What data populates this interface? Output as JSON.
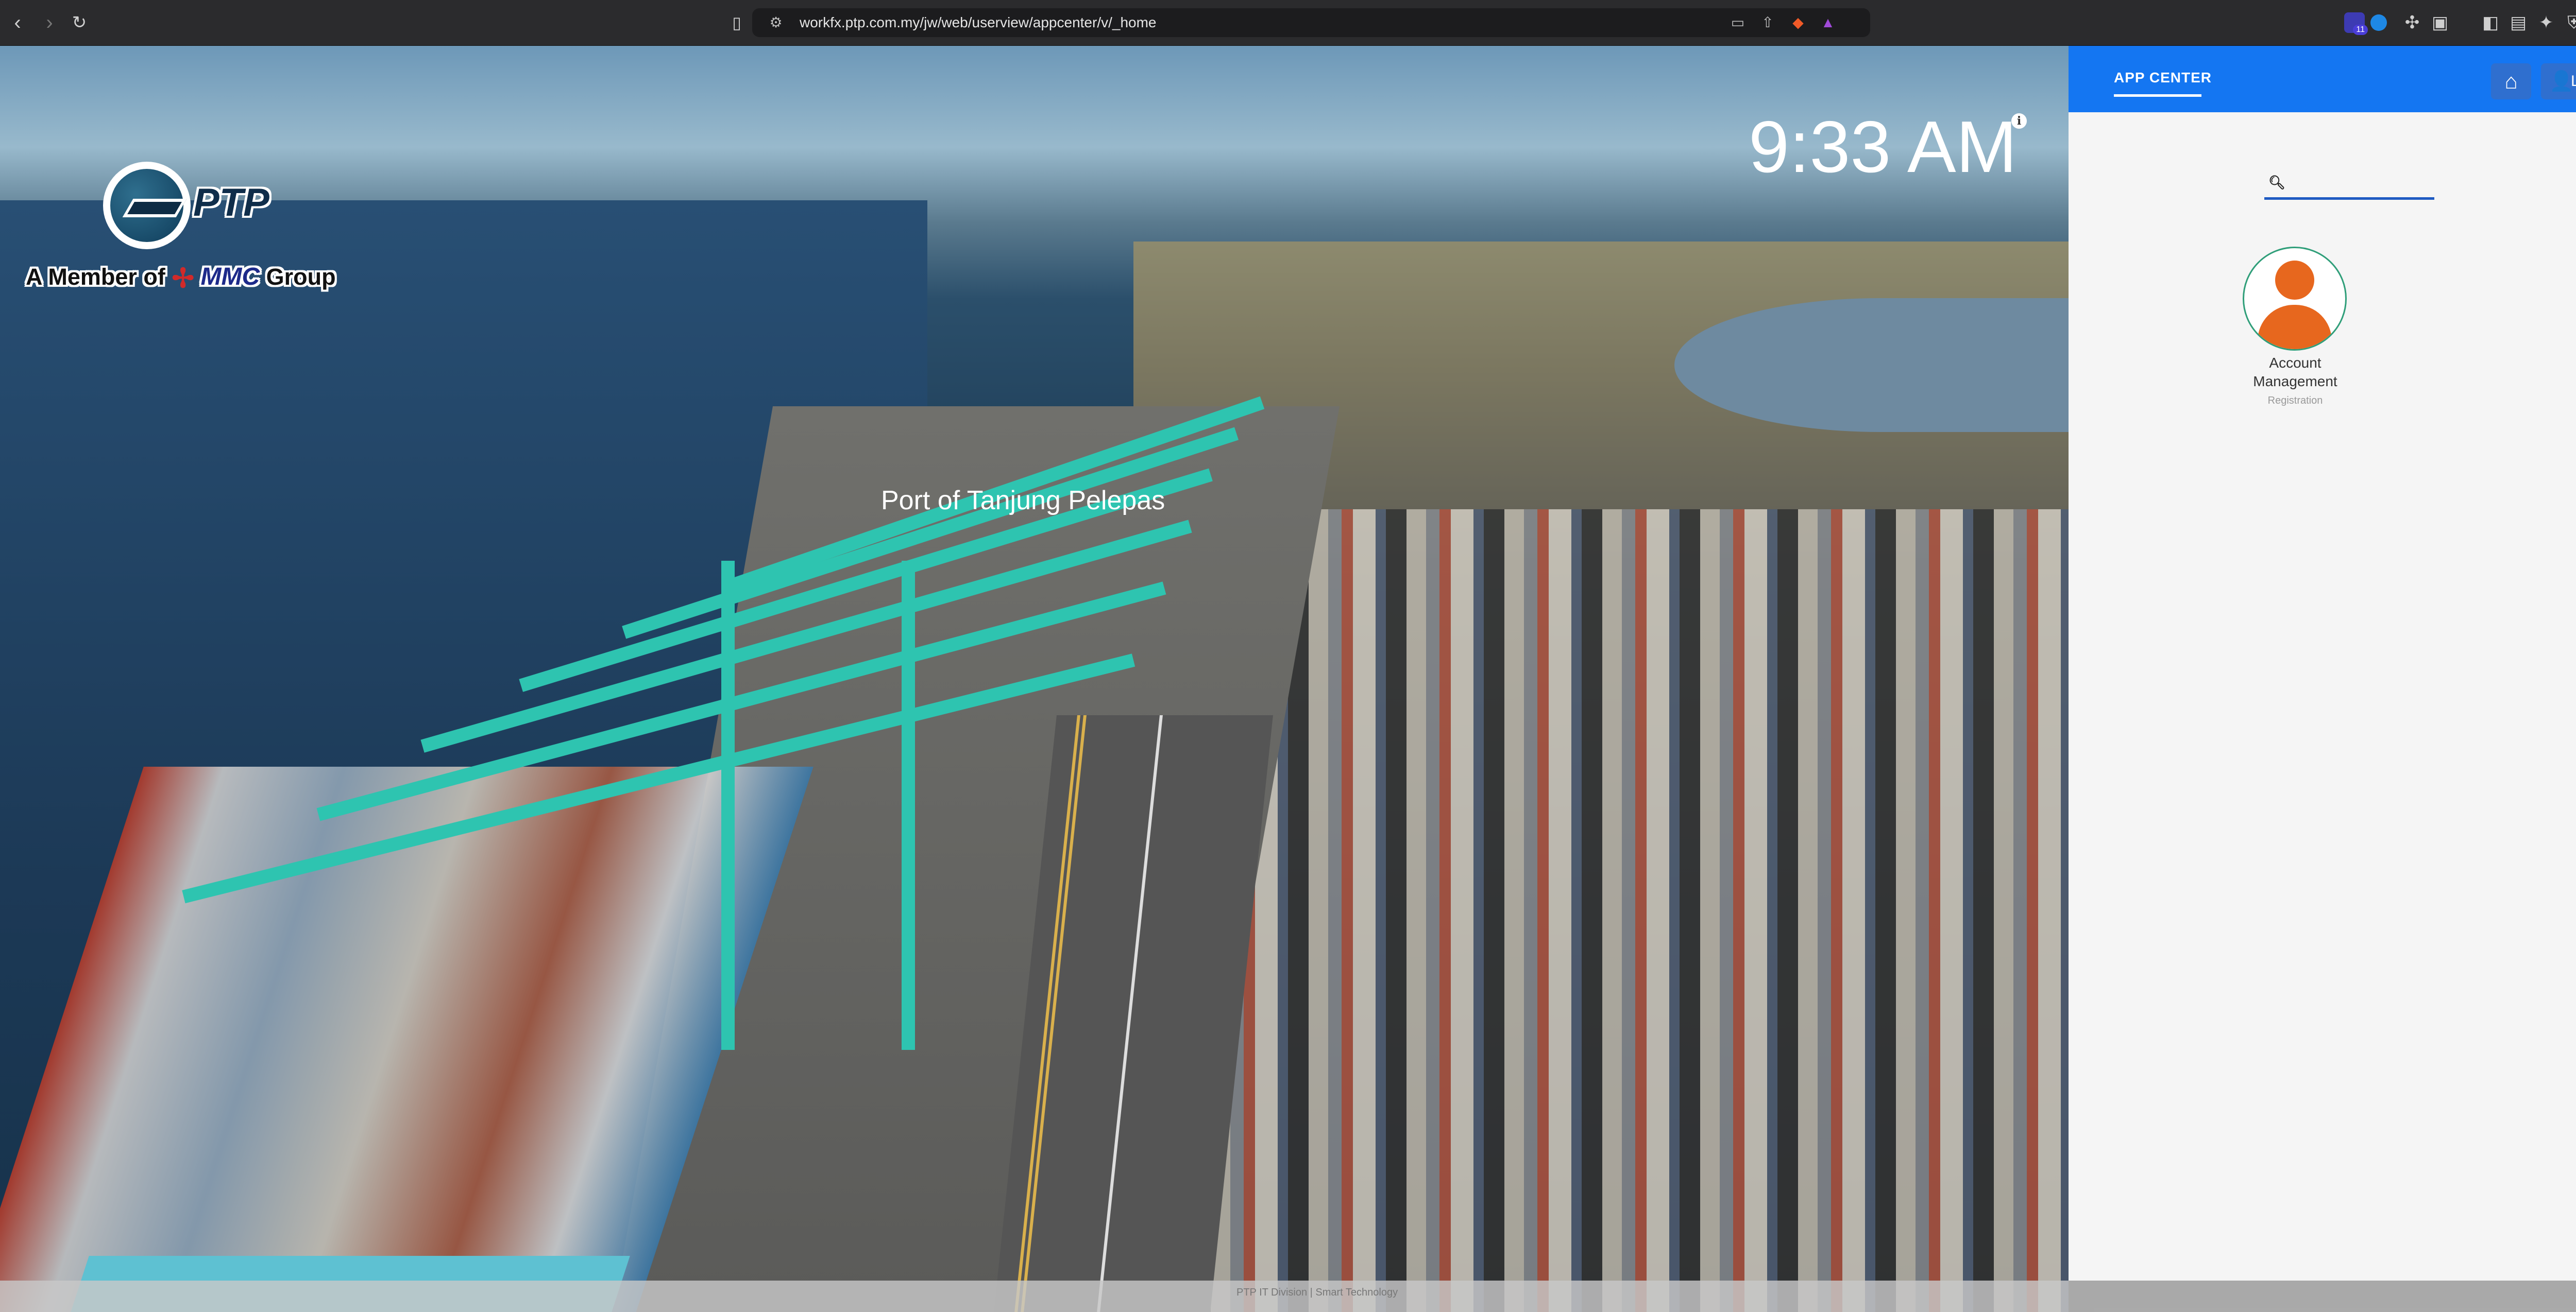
{
  "browser": {
    "url": "workfx.ptp.com.my/jw/web/userview/appcenter/v/_home",
    "icons": {
      "back": "chevron-left-icon",
      "forward": "chevron-right-icon",
      "reload": "reload-icon",
      "bookmark": "bookmark-icon",
      "site_settings": "site-settings-icon",
      "cast": "cast-icon",
      "share": "share-icon",
      "brave_shields": "brave-shields-icon",
      "brave_rewards": "brave-rewards-icon",
      "sidebar": "sidebar-icon",
      "wallet": "wallet-icon",
      "leo": "leo-ai-icon",
      "vpn": "vpn-icon",
      "menu": "menu-icon"
    },
    "extension_badge": "11"
  },
  "hero": {
    "clock": "9:33 AM",
    "place_label": "Port of Tanjung Pelepas",
    "logo": {
      "brand": "PTP",
      "member_prefix": "A Member of",
      "group_brand": "MMC",
      "group_suffix": "Group"
    },
    "footer": "PTP IT Division | Smart Technology"
  },
  "sidebar": {
    "tab_label": "APP CENTER",
    "login_label": "Login",
    "search": {
      "placeholder": "",
      "value": ""
    },
    "apps": [
      {
        "name": "Account Management",
        "subtitle": "Registration",
        "icon": "user-icon"
      }
    ]
  },
  "colors": {
    "topbar": "#1476f2",
    "accent_orange": "#e7671e",
    "avatar_border": "#2f9e79"
  }
}
